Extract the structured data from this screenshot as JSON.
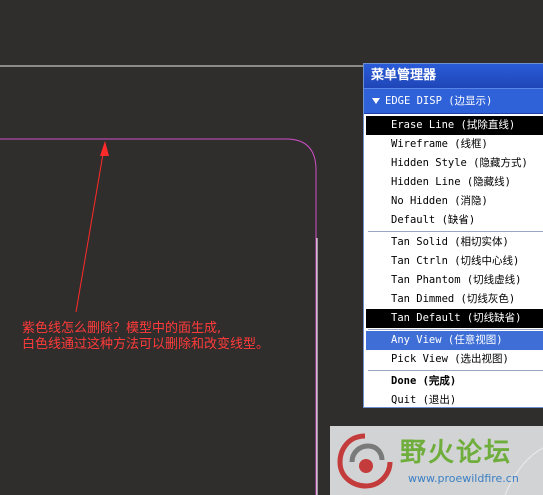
{
  "annotation": {
    "line1": "紫色线怎么删除？模型中的面生成,",
    "line2": "白色线通过这种方法可以删除和改变线型。"
  },
  "menu": {
    "title": "菜单管理器",
    "submenu": "EDGE DISP (边显示)",
    "groups": [
      [
        {
          "label": "Erase Line (拭除直线)",
          "state": "selected"
        },
        {
          "label": "Wireframe (线框)",
          "state": ""
        },
        {
          "label": "Hidden Style (隐藏方式)",
          "state": ""
        },
        {
          "label": "Hidden Line (隐藏线)",
          "state": ""
        },
        {
          "label": "No Hidden (消隐)",
          "state": ""
        },
        {
          "label": "Default (缺省)",
          "state": ""
        }
      ],
      [
        {
          "label": "Tan Solid (相切实体)",
          "state": ""
        },
        {
          "label": "Tan Ctrln (切线中心线)",
          "state": ""
        },
        {
          "label": "Tan Phantom (切线虚线)",
          "state": ""
        },
        {
          "label": "Tan Dimmed (切线灰色)",
          "state": ""
        },
        {
          "label": "Tan Default (切线缺省)",
          "state": "selected"
        }
      ],
      [
        {
          "label": "Any View (任意视图)",
          "state": "hover"
        },
        {
          "label": "Pick View (选出视图)",
          "state": ""
        }
      ],
      [
        {
          "label": "Done (完成)",
          "state": "bold"
        },
        {
          "label": "Quit (退出)",
          "state": ""
        }
      ]
    ]
  },
  "watermark": {
    "name": "野火论坛",
    "url": "www.proewildfire.cn"
  },
  "colors": {
    "background": "#302e2c",
    "edge_white": "#e6e6e6",
    "edge_purple": "#d050c8",
    "annotation": "#ff3a3a",
    "menu_title": "#2450c8"
  }
}
